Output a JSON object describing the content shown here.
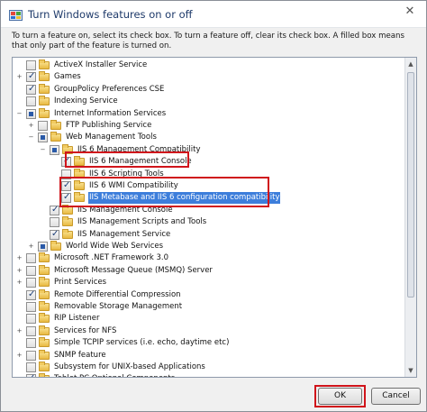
{
  "window": {
    "title": "Turn Windows features on or off"
  },
  "titlebar": {
    "close_glyph": "✕"
  },
  "description": "To turn a feature on, select its check box. To turn a feature off, clear its check box. A filled box means that only part of the feature is turned on.",
  "features": [
    {
      "label": "ActiveX Installer Service",
      "state": "unchecked",
      "expander": ""
    },
    {
      "label": "Games",
      "state": "checked",
      "expander": "+"
    },
    {
      "label": "GroupPolicy Preferences CSE",
      "state": "checked",
      "expander": ""
    },
    {
      "label": "Indexing Service",
      "state": "unchecked",
      "expander": ""
    },
    {
      "label": "Internet Information Services",
      "state": "partial",
      "expander": "−"
    },
    {
      "label": "FTP Publishing Service",
      "state": "unchecked",
      "expander": "+"
    },
    {
      "label": "Web Management Tools",
      "state": "partial",
      "expander": "−"
    },
    {
      "label": "IIS 6 Management Compatibility",
      "state": "partial",
      "expander": "−"
    },
    {
      "label": "IIS 6 Management Console",
      "state": "checked",
      "expander": ""
    },
    {
      "label": "IIS 6 Scripting Tools",
      "state": "unchecked",
      "expander": ""
    },
    {
      "label": "IIS 6 WMI Compatibility",
      "state": "checked",
      "expander": ""
    },
    {
      "label": "IIS Metabase and IIS 6 configuration compatibility",
      "state": "checked",
      "expander": "",
      "selected": true
    },
    {
      "label": "IIS Management Console",
      "state": "checked",
      "expander": ""
    },
    {
      "label": "IIS Management Scripts and Tools",
      "state": "unchecked",
      "expander": ""
    },
    {
      "label": "IIS Management Service",
      "state": "checked",
      "expander": ""
    },
    {
      "label": "World Wide Web Services",
      "state": "partial",
      "expander": "+"
    },
    {
      "label": "Microsoft .NET Framework 3.0",
      "state": "unchecked",
      "expander": "+"
    },
    {
      "label": "Microsoft Message Queue (MSMQ) Server",
      "state": "unchecked",
      "expander": "+"
    },
    {
      "label": "Print Services",
      "state": "unchecked",
      "expander": "+"
    },
    {
      "label": "Remote Differential Compression",
      "state": "checked",
      "expander": ""
    },
    {
      "label": "Removable Storage Management",
      "state": "unchecked",
      "expander": ""
    },
    {
      "label": "RIP Listener",
      "state": "unchecked",
      "expander": ""
    },
    {
      "label": "Services for NFS",
      "state": "unchecked",
      "expander": "+"
    },
    {
      "label": "Simple TCPIP services (i.e. echo, daytime etc)",
      "state": "unchecked",
      "expander": ""
    },
    {
      "label": "SNMP feature",
      "state": "unchecked",
      "expander": "+"
    },
    {
      "label": "Subsystem for UNIX-based Applications",
      "state": "unchecked",
      "expander": ""
    },
    {
      "label": "Tablet PC Optional Components",
      "state": "checked",
      "expander": ""
    }
  ],
  "buttons": {
    "ok": "OK",
    "cancel": "Cancel"
  },
  "colors": {
    "highlight_box": "#d0141b",
    "selection": "#3d7edb",
    "title_text": "#1e3a6a"
  },
  "icons": {
    "window": "windows-features-icon",
    "folder": "folder-icon",
    "close": "close-icon"
  }
}
